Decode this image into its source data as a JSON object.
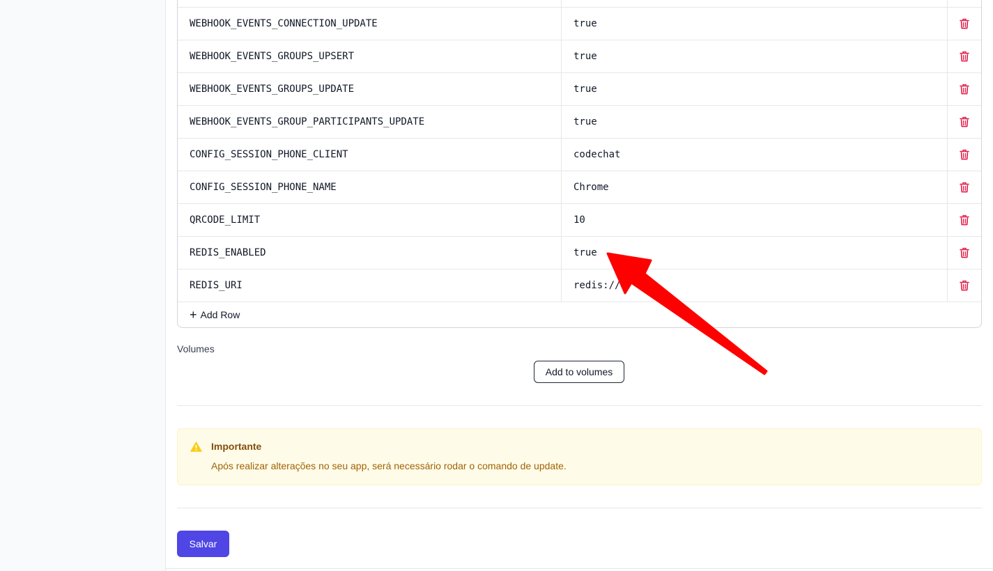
{
  "env_rows": [
    {
      "key": "WEBHOOK_EVENTS_CONNECTION_UPDATE",
      "value": "true"
    },
    {
      "key": "WEBHOOK_EVENTS_GROUPS_UPSERT",
      "value": "true"
    },
    {
      "key": "WEBHOOK_EVENTS_GROUPS_UPDATE",
      "value": "true"
    },
    {
      "key": "WEBHOOK_EVENTS_GROUP_PARTICIPANTS_UPDATE",
      "value": "true"
    },
    {
      "key": "CONFIG_SESSION_PHONE_CLIENT",
      "value": "codechat"
    },
    {
      "key": "CONFIG_SESSION_PHONE_NAME",
      "value": "Chrome"
    },
    {
      "key": "QRCODE_LIMIT",
      "value": "10"
    },
    {
      "key": "REDIS_ENABLED",
      "value": "true"
    },
    {
      "key": "REDIS_URI",
      "value": "redis://"
    }
  ],
  "row_action_icon": "trash-icon",
  "add_row_label": "Add Row",
  "volumes": {
    "label": "Volumes",
    "add_button_label": "Add to volumes"
  },
  "alert": {
    "icon": "warning-icon",
    "title": "Importante",
    "message": "Após realizar alterações no seu app, será necessário rodar o comando de update."
  },
  "save_button_label": "Salvar",
  "colors": {
    "accent": "#4f46e5",
    "delete": "#e11d48",
    "alert_bg": "#fefce8",
    "alert_icon": "#facc15",
    "annotation_arrow": "#ff0000"
  }
}
